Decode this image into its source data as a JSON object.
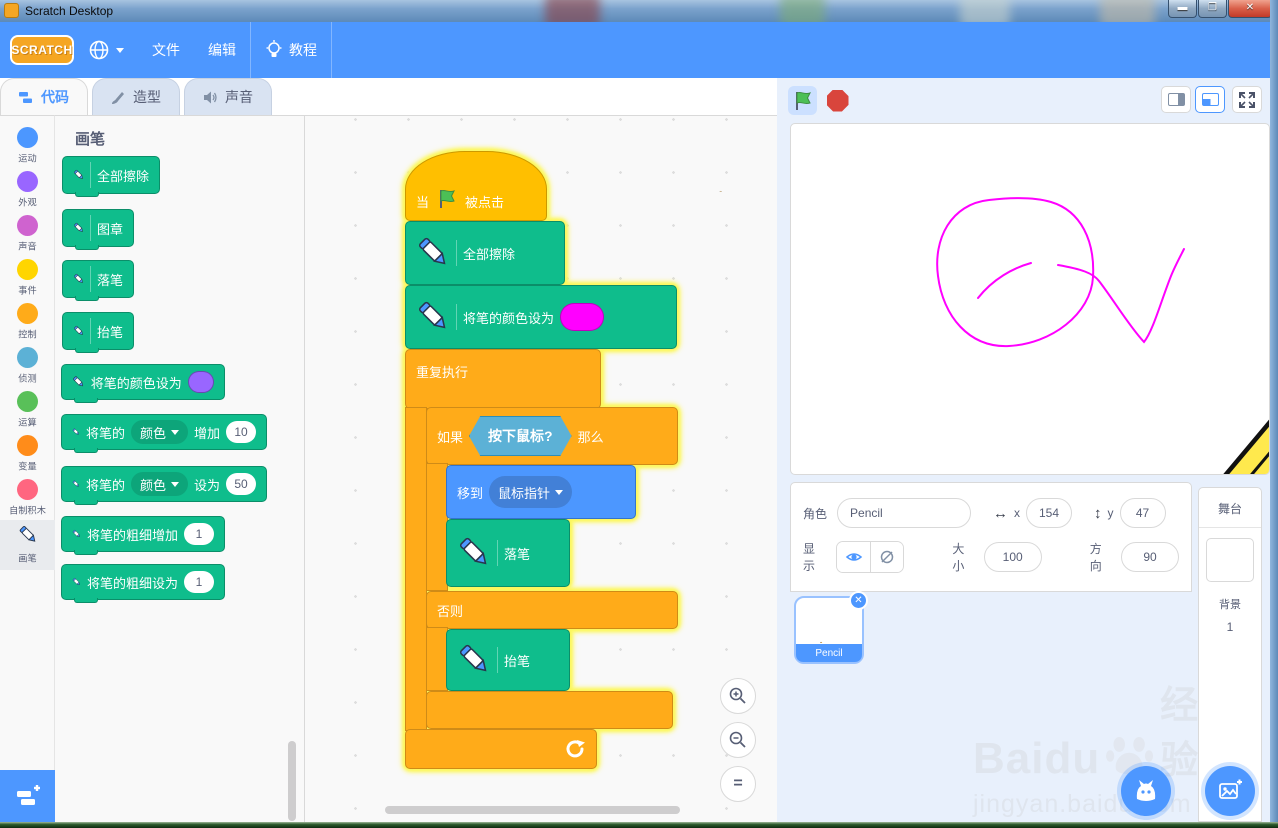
{
  "titlebar": {
    "title": "Scratch Desktop"
  },
  "menubar": {
    "logo": "SCRATCH",
    "file": "文件",
    "edit": "编辑",
    "tutorials": "教程"
  },
  "tabs": {
    "code": "代码",
    "costumes": "造型",
    "sounds": "声音"
  },
  "categories": [
    {
      "label": "运动",
      "color": "#4C97FF"
    },
    {
      "label": "外观",
      "color": "#9966FF"
    },
    {
      "label": "声音",
      "color": "#CF63CF"
    },
    {
      "label": "事件",
      "color": "#FFD500"
    },
    {
      "label": "控制",
      "color": "#FFAB19"
    },
    {
      "label": "侦测",
      "color": "#5CB1D6"
    },
    {
      "label": "运算",
      "color": "#59C059"
    },
    {
      "label": "变量",
      "color": "#FF8C1A"
    },
    {
      "label": "自制积木",
      "color": "#FF6680"
    },
    {
      "label": "画笔",
      "selected": true
    }
  ],
  "palette": {
    "header": "画笔",
    "erase_all": "全部擦除",
    "stamp": "图章",
    "pen_down": "落笔",
    "pen_up": "抬笔",
    "set_color_label": "将笔的颜色设为",
    "swatch_color": "#9966FF",
    "change_prefix": "将笔的",
    "color_option": "颜色",
    "change_by": "增加",
    "change_value": "10",
    "set_to": "设为",
    "set_value": "50",
    "change_size_label": "将笔的粗细增加",
    "change_size_value": "1",
    "set_size_label": "将笔的粗细设为",
    "set_size_value": "1"
  },
  "script": {
    "hat_prefix": "当",
    "hat_suffix": "被点击",
    "erase_all": "全部擦除",
    "set_color_label": "将笔的颜色设为",
    "set_color_value": "#FF00FF",
    "forever": "重复执行",
    "if_label": "如果",
    "condition": "按下鼠标?",
    "then_label": "那么",
    "else_label": "否则",
    "move_label": "移到",
    "move_target": "鼠标指针",
    "pen_down": "落笔",
    "pen_up": "抬笔"
  },
  "sprite_panel": {
    "sprite_label": "角色",
    "sprite_name": "Pencil",
    "x_label": "x",
    "x_value": "154",
    "y_label": "y",
    "y_value": "47",
    "show_label": "显示",
    "size_label": "大小",
    "size_value": "100",
    "direction_label": "方向",
    "direction_value": "90"
  },
  "sprite_list": {
    "selected_sprite": "Pencil"
  },
  "stage_panel": {
    "title": "舞台",
    "backdrops_label": "背景",
    "backdrop_count": "1"
  },
  "watermark": {
    "brand": "Baidu",
    "brand_suffix": "经验",
    "url": "jingyan.baidu.com"
  },
  "colors": {
    "accent": "#4D97FF",
    "pen_block": "#0FBD8C",
    "control_block": "#FFAB19",
    "event_block": "#FFBF00",
    "motion_block": "#4C97FF",
    "sensing_block": "#5CB1D6",
    "pen_trail": "#FF00FF",
    "script_glow": "#FCF75E",
    "stop_button": "#D9453C",
    "flag_green": "#4CBF56"
  }
}
